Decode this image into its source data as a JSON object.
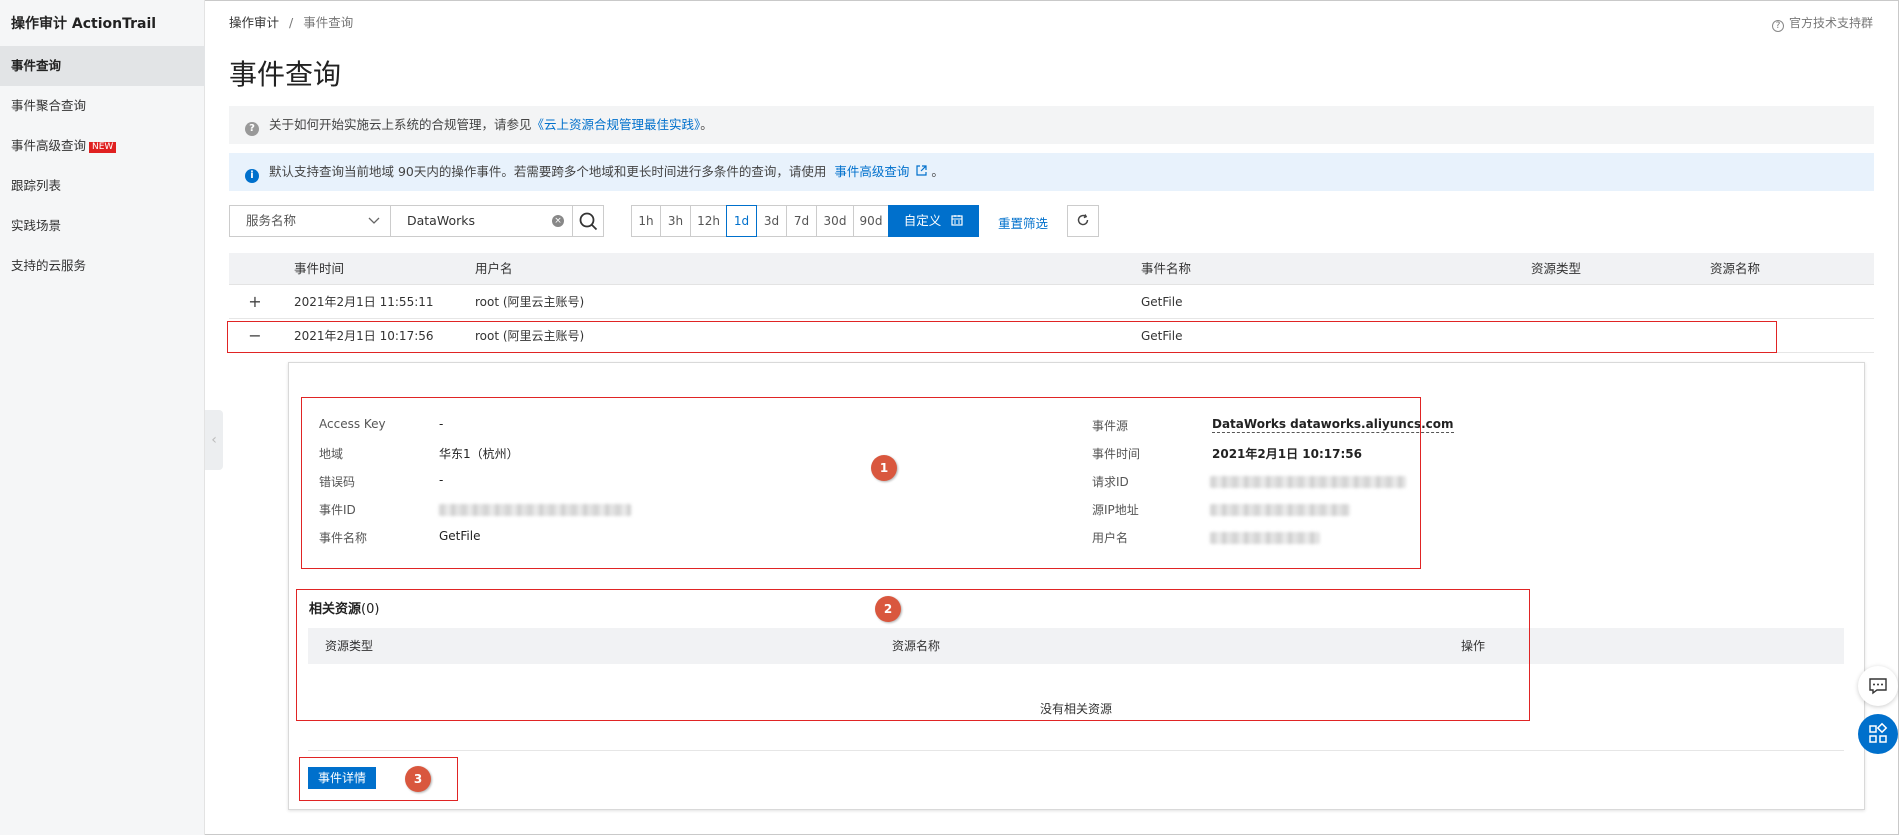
{
  "sidebar": {
    "title": "操作审计 ActionTrail",
    "items": [
      {
        "label": "事件查询",
        "active": true
      },
      {
        "label": "事件聚合查询"
      },
      {
        "label": "事件高级查询",
        "badge": "NEW"
      },
      {
        "label": "跟踪列表"
      },
      {
        "label": "实践场景"
      },
      {
        "label": "支持的云服务"
      }
    ]
  },
  "header": {
    "breadcrumb": [
      "操作审计",
      "事件查询"
    ],
    "breadcrumb_sep": "/",
    "support_link": "官方技术支持群",
    "title": "事件查询"
  },
  "notices": {
    "compliance": {
      "prefix": "关于如何开始实施云上系统的合规管理，请参见",
      "link": "《云上资源合规管理最佳实践》",
      "suffix": "。"
    },
    "info": {
      "text": "默认支持查询当前地域 90天内的操作事件。若需要跨多个地域和更长时间进行多条件的查询，请使用",
      "link": "事件高级查询",
      "suffix": "。"
    }
  },
  "filter": {
    "select_value": "服务名称",
    "search_value": "DataWorks",
    "ranges": [
      "1h",
      "3h",
      "12h",
      "1d",
      "3d",
      "7d",
      "30d",
      "90d"
    ],
    "active_range": "1d",
    "custom_label": "自定义",
    "reset_label": "重置筛选"
  },
  "table": {
    "columns": [
      "事件时间",
      "用户名",
      "事件名称",
      "资源类型",
      "资源名称"
    ],
    "rows": [
      {
        "expand": "+",
        "time": "2021年2月1日 11:55:11",
        "user": "root (阿里云主账号)",
        "event": "GetFile"
      },
      {
        "expand": "−",
        "time": "2021年2月1日 10:17:56",
        "user": "root (阿里云主账号)",
        "event": "GetFile"
      }
    ]
  },
  "detail": {
    "left": [
      {
        "label": "Access Key",
        "value": "-"
      },
      {
        "label": "地域",
        "value": "华东1（杭州）"
      },
      {
        "label": "错误码",
        "value": "-"
      },
      {
        "label": "事件ID",
        "value": ""
      },
      {
        "label": "事件名称",
        "value": "GetFile"
      }
    ],
    "right": [
      {
        "label": "事件源",
        "value": "DataWorks dataworks.aliyuncs.com"
      },
      {
        "label": "事件时间",
        "value": "2021年2月1日 10:17:56"
      },
      {
        "label": "请求ID",
        "value": ""
      },
      {
        "label": "源IP地址",
        "value": ""
      },
      {
        "label": "用户名",
        "value": ""
      }
    ],
    "resources": {
      "title": "相关资源",
      "count": "(0)",
      "columns": [
        "资源类型",
        "资源名称",
        "操作"
      ],
      "empty_text": "没有相关资源"
    },
    "detail_button": "事件详情"
  },
  "annotations": [
    "1",
    "2",
    "3"
  ]
}
